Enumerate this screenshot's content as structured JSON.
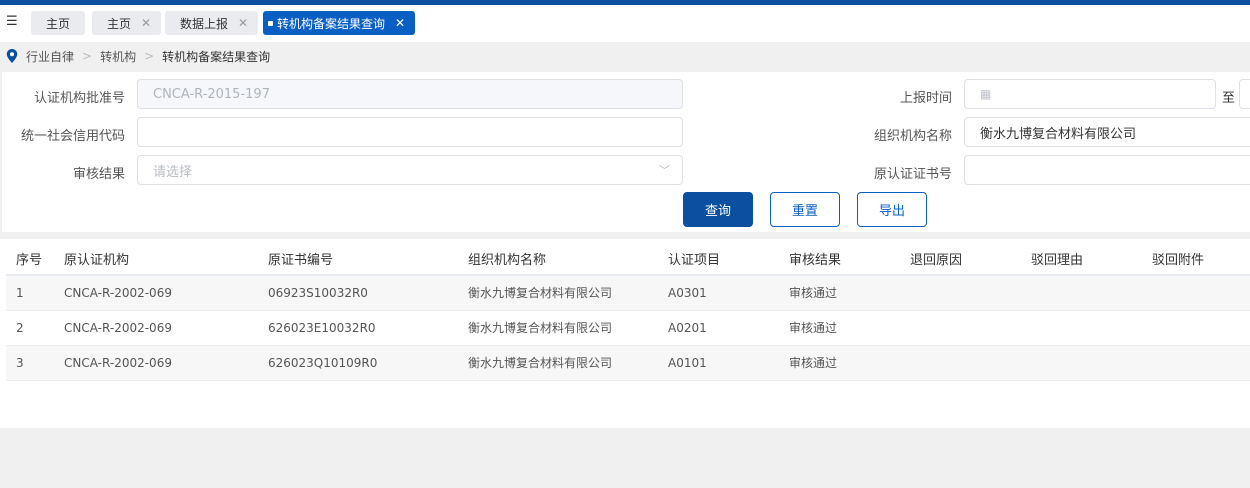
{
  "tabs": [
    {
      "label": "主页",
      "closable": false
    },
    {
      "label": "主页",
      "closable": true
    },
    {
      "label": "数据上报",
      "closable": true
    },
    {
      "label": "转机构备案结果查询",
      "closable": true,
      "active": true
    }
  ],
  "breadcrumb": [
    "行业自律",
    "转机构",
    "转机构备案结果查询"
  ],
  "form": {
    "cert_no_label": "认证机构批准号",
    "cert_no_value": "CNCA-R-2015-197",
    "credit_code_label": "统一社会信用代码",
    "credit_code_value": "",
    "review_label": "审核结果",
    "review_placeholder": "请选择",
    "report_time_label": "上报时间",
    "to_label": "至",
    "org_name_label": "组织机构名称",
    "org_name_value": "衡水九博复合材料有限公司",
    "orig_cert_label": "原认证证书号",
    "orig_cert_value": ""
  },
  "buttons": {
    "query": "查询",
    "reset": "重置",
    "export": "导出"
  },
  "table": {
    "headers": [
      "序号",
      "原认证机构",
      "原证书编号",
      "组织机构名称",
      "认证项目",
      "审核结果",
      "退回原因",
      "驳回理由",
      "驳回附件"
    ],
    "rows": [
      [
        "1",
        "CNCA-R-2002-069",
        "06923S10032R0",
        "衡水九博复合材料有限公司",
        "A0301",
        "审核通过",
        "",
        "",
        ""
      ],
      [
        "2",
        "CNCA-R-2002-069",
        "626023E10032R0",
        "衡水九博复合材料有限公司",
        "A0201",
        "审核通过",
        "",
        "",
        ""
      ],
      [
        "3",
        "CNCA-R-2002-069",
        "626023Q10109R0",
        "衡水九博复合材料有限公司",
        "A0101",
        "审核通过",
        "",
        "",
        ""
      ]
    ]
  }
}
